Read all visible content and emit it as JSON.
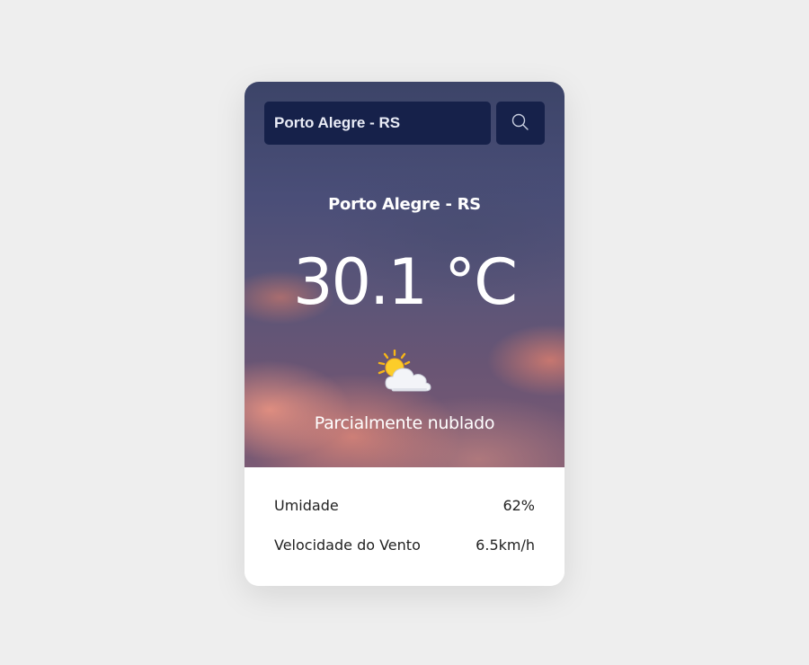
{
  "search": {
    "value": "Porto Alegre - RS",
    "button_icon": "search-icon"
  },
  "weather": {
    "city": "Porto Alegre - RS",
    "temperature": "30.1 °C",
    "icon": "partly-cloudy-icon",
    "condition": "Parcialmente nublado"
  },
  "details": [
    {
      "label": "Umidade",
      "value": "62%"
    },
    {
      "label": "Velocidade do Vento",
      "value": "6.5km/h"
    }
  ],
  "colors": {
    "page_background": "#eeeeee",
    "input_background": "#16214a",
    "card_bottom": "#ffffff"
  }
}
